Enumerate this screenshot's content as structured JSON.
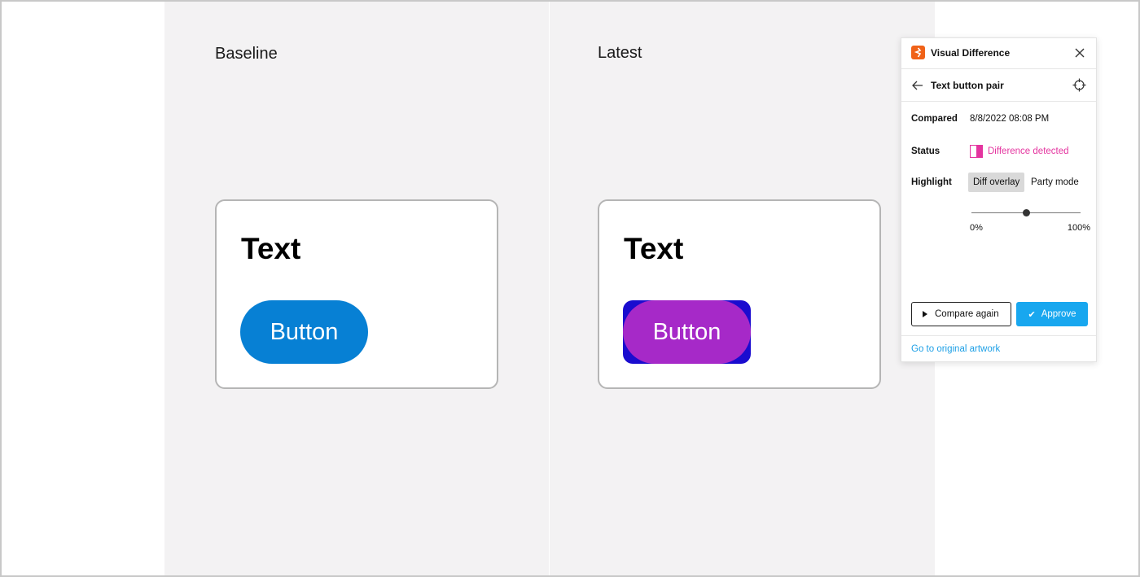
{
  "baseline": {
    "label": "Baseline",
    "card_text": "Text",
    "button_label": "Button"
  },
  "latest": {
    "label": "Latest",
    "card_text": "Text",
    "button_label": "Button"
  },
  "panel": {
    "title": "Visual Difference",
    "item_title": "Text button pair",
    "compared_label": "Compared",
    "compared_value": "8/8/2022 08:08 PM",
    "status_label": "Status",
    "status_value": "Difference detected",
    "highlight_label": "Highlight",
    "modes": [
      "Diff overlay",
      "Party mode"
    ],
    "active_mode": "Diff overlay",
    "slider": {
      "min_label": "0%",
      "max_label": "100%",
      "value": 0.5
    },
    "compare_again_label": "Compare again",
    "approve_label": "Approve",
    "artwork_link": "Go to original artwork"
  },
  "colors": {
    "baseline_button": "#0780d4",
    "diff_overlay_box": "#1a0ccf",
    "diff_overlay_pill": "#a629c8",
    "status": "#e4349f",
    "approve": "#18a7ef",
    "logo": "#f06218"
  },
  "icons": [
    "app-logo-icon",
    "close-icon",
    "back-arrow-icon",
    "crosshair-icon",
    "status-diff-icon",
    "play-icon",
    "check-icon"
  ]
}
